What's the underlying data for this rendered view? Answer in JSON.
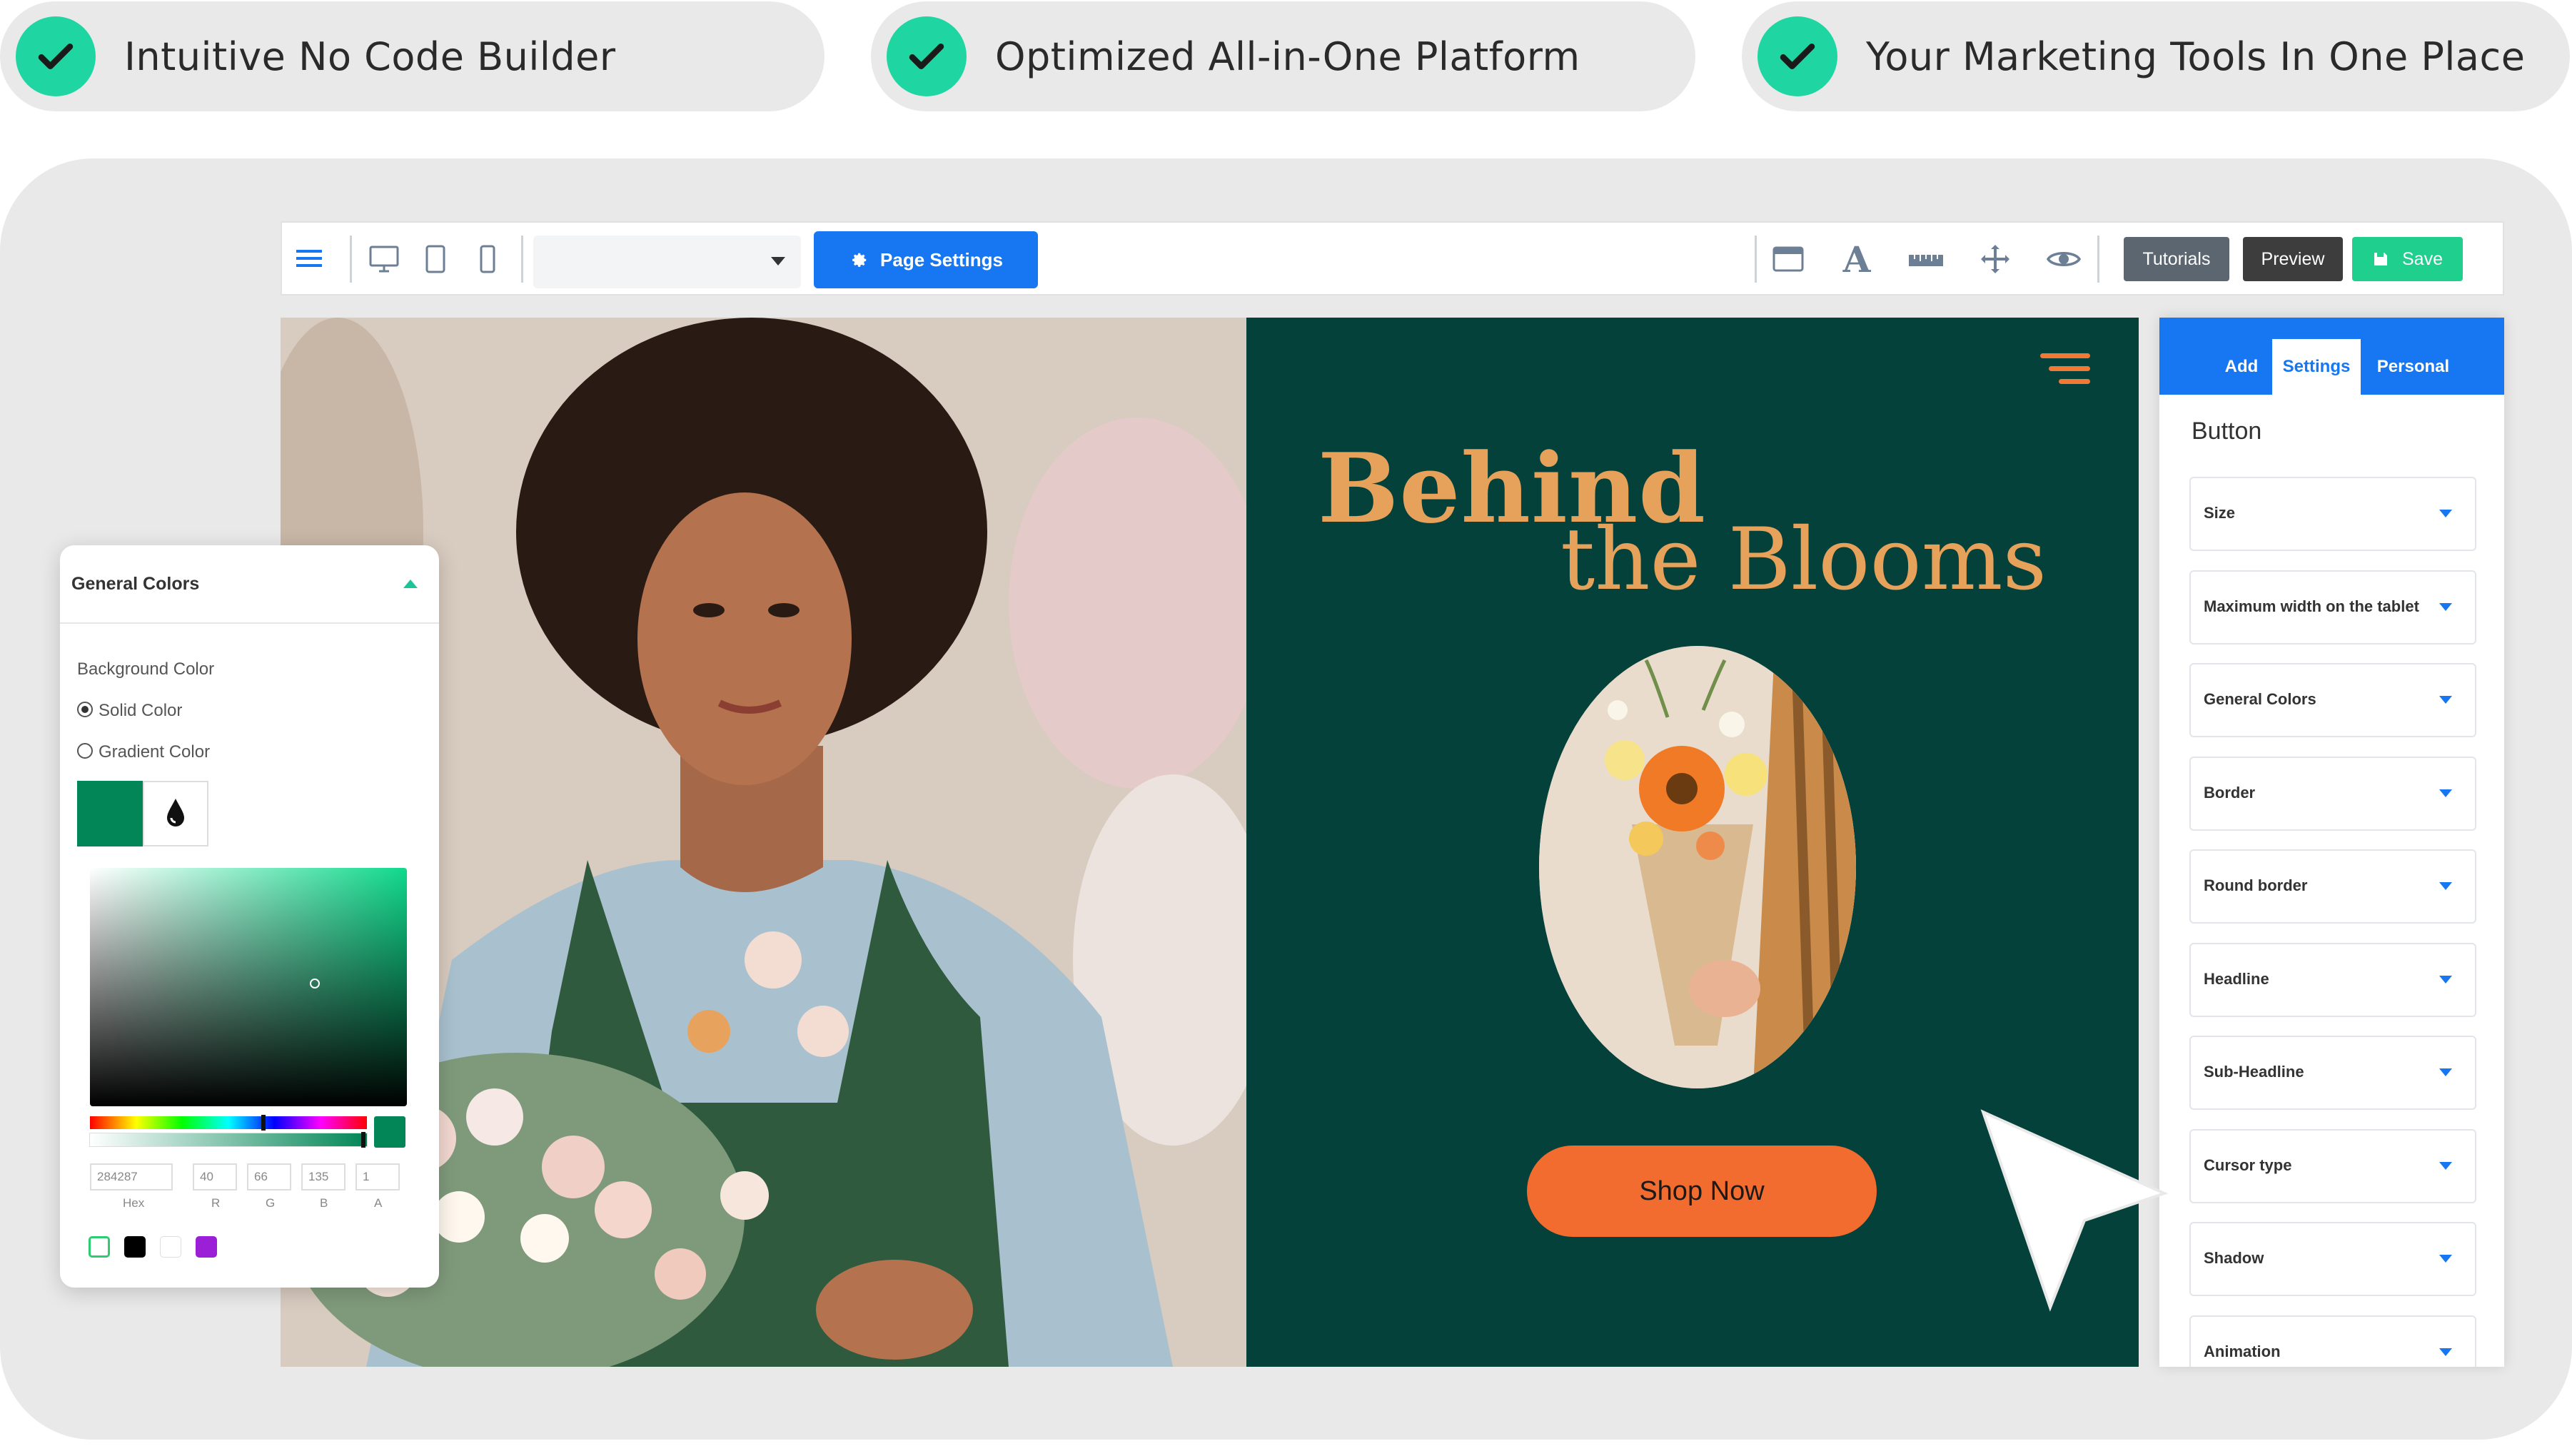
{
  "features": [
    {
      "label": "Intuitive No Code Builder"
    },
    {
      "label": "Optimized All-in-One Platform"
    },
    {
      "label": "Your Marketing Tools In One Place"
    }
  ],
  "toolbar": {
    "page_settings": "Page Settings",
    "tutorials": "Tutorials",
    "preview": "Preview",
    "save": "Save",
    "device_select_value": ""
  },
  "hero": {
    "title_line1": "Behind",
    "title_line2": "the Blooms",
    "button": "Shop Now",
    "colors": {
      "bg": "#04413a",
      "title": "#e6a25b",
      "button": "#f36c2f"
    }
  },
  "panel": {
    "tabs": [
      "Add",
      "Settings",
      "Personal"
    ],
    "active_tab": "Settings",
    "title": "Button",
    "sections": [
      "Size",
      "Maximum width on the tablet",
      "General Colors",
      "Border",
      "Round border",
      "Headline",
      "Sub-Headline",
      "Cursor type",
      "Shadow",
      "Animation"
    ]
  },
  "colors_popup": {
    "title": "General Colors",
    "background_label": "Background Color",
    "solid_label": "Solid Color",
    "gradient_label": "Gradient Color",
    "hex": "284287",
    "r": "40",
    "g": "66",
    "b": "135",
    "a": "1",
    "field_labels": [
      "Hex",
      "R",
      "G",
      "B",
      "A"
    ],
    "swatch_color": "#028657",
    "presets": [
      "#2ecc71",
      "#000000",
      "#ffffff",
      "#9b1fd6"
    ]
  },
  "accent": {
    "check": "#1fd6a2",
    "primary": "#1777f2"
  }
}
